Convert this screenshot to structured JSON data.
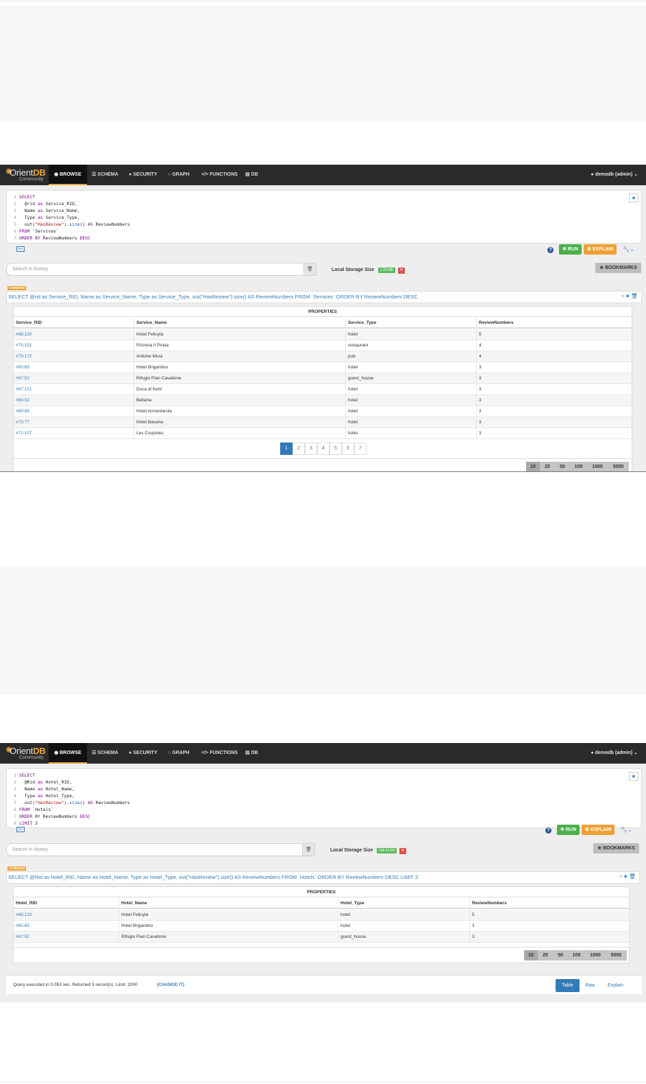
{
  "nav": {
    "brand_prefix": "Orient",
    "brand_suffix": "DB",
    "brand_sub": "Community",
    "browse": "BROWSE",
    "schema": "SCHEMA",
    "security": "SECURITY",
    "graph": "GRAPH",
    "functions": "FUNCTIONS",
    "db": "DB",
    "user": "demodb (admin)"
  },
  "toolbar": {
    "run": "RUN",
    "explain": "EXPLAIN",
    "help": "?",
    "search_placeholder": "Search in history",
    "local_storage_label": "Local Storage Size",
    "bookmarks": "BOOKMARKS",
    "command_badge": "COMMAND",
    "properties": "PROPERTIES"
  },
  "query1": {
    "storage_size": "1.08 MB",
    "query_text": "SELECT @rid as Service_RID, Name as Service_Name, Type as Service_Type, out(\"HasReview\").size() AS ReviewNumbers FROM `Services` ORDER BY ReviewNumbers DESC",
    "columns": [
      "Service_RID",
      "Service_Name",
      "Service_Type",
      "ReviewNumbers"
    ],
    "rows": [
      [
        "#68:120",
        "Hotel Felicyta",
        "hotel",
        "5"
      ],
      [
        "#75:152",
        "Pizzeria Il Pirata",
        "restaurant",
        "4"
      ],
      [
        "#79:172",
        "Antiche Mura",
        "pub",
        "4"
      ],
      [
        "#65:65",
        "Hotel Brigantino",
        "hotel",
        "3"
      ],
      [
        "#67:52",
        "Rifugio Pian Cavallone",
        "guest_house",
        "3"
      ],
      [
        "#67:121",
        "Duca di Kent",
        "hotel",
        "3"
      ],
      [
        "#69:52",
        "Bellarta",
        "hotel",
        "3"
      ],
      [
        "#69:86",
        "Hotel Armentarola",
        "hotel",
        "3"
      ],
      [
        "#70:77",
        "Hotel Bavaria",
        "hotel",
        "3"
      ],
      [
        "#71:107",
        "Les Coupoles",
        "hotel",
        "3"
      ]
    ],
    "pages": [
      "1",
      "2",
      "3",
      "4",
      "5",
      "6",
      "7"
    ],
    "page_sizes": [
      "10",
      "25",
      "50",
      "100",
      "1000",
      "5000"
    ]
  },
  "query2": {
    "storage_size": "208.53 KB",
    "query_text": "SELECT @Rid as Hotel_RID, Name as Hotel_Name, Type as Hotel_Type, out(\"HasReview\").size() AS ReviewNumbers FROM `Hotels` ORDER BY ReviewNumbers DESC LIMIT 3",
    "columns": [
      "Hotel_RID",
      "Hotel_Name",
      "Hotel_Type",
      "ReviewNumbers"
    ],
    "rows": [
      [
        "#68:120",
        "Hotel Felicyta",
        "hotel",
        "5"
      ],
      [
        "#65:65",
        "Hotel Brigantino",
        "hotel",
        "3"
      ],
      [
        "#67:52",
        "Rifugio Pian Cavallone",
        "guest_house",
        "3"
      ]
    ],
    "page_sizes": [
      "10",
      "25",
      "50",
      "100",
      "1000",
      "5000"
    ],
    "status": "Query executed in 0.053 sec. Returned 3 record(s). Limit: 2000",
    "change_it": "(CHANGE IT)",
    "view_table": "Table",
    "view_raw": "Raw",
    "view_explain": "Explain"
  },
  "colors": {
    "navbar": "#2a2a2a",
    "accent": "#337ab7",
    "run": "#4cae4c",
    "explain": "#f0a030",
    "brand": "#e8a33c"
  }
}
